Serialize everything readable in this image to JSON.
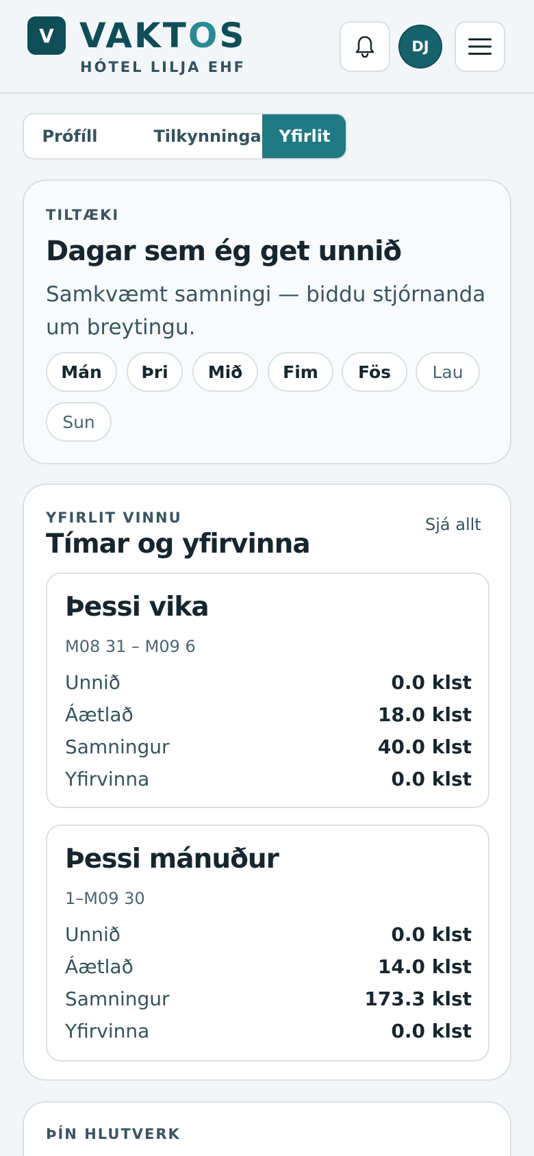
{
  "header": {
    "logo_letter": "V",
    "brand_main": "VAKT",
    "brand_accent": "O",
    "brand_end": "S",
    "company": "HÓTEL LILJA EHF",
    "avatar_initials": "DJ",
    "icons": [
      "bell-icon",
      "menu-icon"
    ]
  },
  "tabs": [
    {
      "label": "Prófíll",
      "active": false
    },
    {
      "label": "Tilkynningar",
      "active": false
    },
    {
      "label": "Yfirlit",
      "active": true
    }
  ],
  "availability": {
    "eyebrow": "TILTÆKI",
    "title": "Dagar sem ég get unnið",
    "description": "Samkvæmt samningi — biddu stjórnanda um breytingu.",
    "days": [
      {
        "label": "Mán",
        "selected": true
      },
      {
        "label": "Þri",
        "selected": true
      },
      {
        "label": "Mið",
        "selected": true
      },
      {
        "label": "Fim",
        "selected": true
      },
      {
        "label": "Fös",
        "selected": true
      },
      {
        "label": "Lau",
        "selected": false
      },
      {
        "label": "Sun",
        "selected": false
      }
    ]
  },
  "summary": {
    "eyebrow": "YFIRLIT VINNU",
    "title": "Tímar og yfirvinna",
    "see_all": "Sjá allt",
    "week": {
      "title": "Þessi vika",
      "range": "M08 31 – M09 6",
      "rows": [
        {
          "label": "Unnið",
          "value": "0.0 klst"
        },
        {
          "label": "Áætlað",
          "value": "18.0 klst"
        },
        {
          "label": "Samningur",
          "value": "40.0 klst"
        },
        {
          "label": "Yfirvinna",
          "value": "0.0 klst"
        }
      ]
    },
    "month": {
      "title": "Þessi mánuður",
      "range": "1–M09 30",
      "rows": [
        {
          "label": "Unnið",
          "value": "0.0 klst"
        },
        {
          "label": "Áætlað",
          "value": "14.0 klst"
        },
        {
          "label": "Samningur",
          "value": "173.3 klst"
        },
        {
          "label": "Yfirvinna",
          "value": "0.0 klst"
        }
      ]
    }
  },
  "roles": {
    "eyebrow": "ÞÍN HLUTVERK"
  },
  "colors": {
    "brand": "#0f4d57",
    "accent": "#2a8a94",
    "active_tab": "#1f7a83",
    "background": "#f3f6f8"
  }
}
